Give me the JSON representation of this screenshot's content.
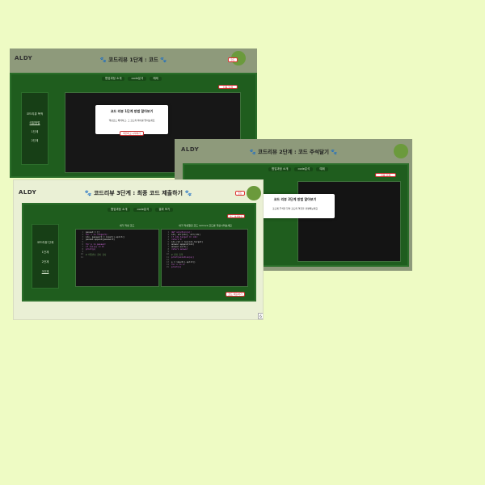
{
  "colors": {
    "page_bg": "#eefbc4",
    "frame_gray": "#8e9a7b",
    "frame_cream": "#eaf0d5",
    "panel_green": "#1f5d1e",
    "editor_dark": "#151515",
    "accent_red": "#cc2222"
  },
  "app": {
    "logo": "ALDY"
  },
  "win1": {
    "title": "코드리뷰 1단계 : 코드",
    "tabs": [
      "협업과정 소개",
      "code분석",
      "예제"
    ],
    "sidebar": [
      "코드리뷰 목적",
      "리뷰방법",
      "1단계",
      "2단계"
    ],
    "next_label": "다음 단계",
    "modal_title": "코드 리뷰 1단계 방법 알아보기",
    "modal_body": "핵심코드 해석하고, 그 코드의 의미를 알아보세요",
    "modal_button": "확인하고 시작하기"
  },
  "win2": {
    "title": "코드리뷰 2단계 : 코드 주석달기",
    "tabs": [
      "협업과정 소개",
      "code분석",
      "예제"
    ],
    "next_label": "다음 단계",
    "modal_title": "코드 리뷰 2단계 방법 알아보기",
    "modal_body": "코드에 주석을 달아 코드의 역할을 설명해보세요"
  },
  "win3": {
    "title": "코드리뷰 3단계 : 최종 코드 제출하기",
    "tabs": [
      "협업과정 소개",
      "code분석",
      "결과 보기"
    ],
    "sidebar": [
      "코드리뷰 단계",
      "1단계",
      "2단계",
      "3단계"
    ],
    "top_right_btn": "코드 분석하기",
    "left_editor_title": "내가 작성 코드",
    "right_editor_title": "내가 작성했던 코드 remove 코드를 개선시켜보세요",
    "submit_btn": "코드 제출하기",
    "page_num": "6"
  },
  "code_left": [
    {
      "n": "1",
      "t": "passwd = []"
    },
    {
      "n": "2",
      "t": "for i in range(5):"
    },
    {
      "n": "3",
      "t": "    idx, password = input().split()"
    },
    {
      "n": "4",
      "t": "    passwd.append(password)"
    },
    {
      "n": "5",
      "t": ""
    },
    {
      "n": "6",
      "t": "for p in passwd:"
    },
    {
      "n": "7",
      "t": "    if len(p) >= 8:"
    },
    {
      "n": "8",
      "t": "        print(p)"
    },
    {
      "n": "9",
      "t": ""
    },
    {
      "n": "10",
      "t": "# 비밀번호 길이 검사"
    },
    {
      "n": "11",
      "t": ""
    }
  ],
  "code_right": [
    {
      "n": "1",
      "t": "def solution(s):"
    },
    {
      "n": "2",
      "t": "    idx, str(idx), str(idx)"
    },
    {
      "n": "3",
      "t": "    if idx_target == idx:"
    },
    {
      "n": "4",
      "t": "        return 0"
    },
    {
      "n": "5",
      "t": "    idx_ret = len(idx_target)"
    },
    {
      "n": "6",
      "t": "    answer.append(idx)"
    },
    {
      "n": "7",
      "t": "    answer.sort()"
    },
    {
      "n": "8",
      "t": "    return answer"
    },
    {
      "n": "9",
      "t": ""
    },
    {
      "n": "10",
      "t": "# 결과 출력"
    },
    {
      "n": "11",
      "t": "print(solution(s))"
    },
    {
      "n": "12",
      "t": ""
    },
    {
      "n": "13",
      "t": "s = input().split()"
    },
    {
      "n": "14",
      "t": "for x in s:"
    },
    {
      "n": "15",
      "t": "    print(x)"
    }
  ]
}
